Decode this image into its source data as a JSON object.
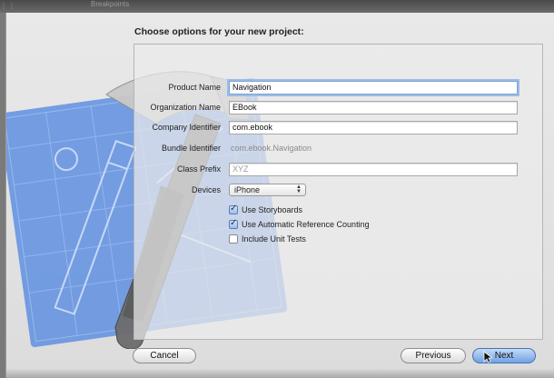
{
  "background": {
    "breakpoints_label": "Breakpoints"
  },
  "dialog": {
    "title": "Choose options for your new project:"
  },
  "form": {
    "product_name": {
      "label": "Product Name",
      "value": "Navigation"
    },
    "organization_name": {
      "label": "Organization Name",
      "value": "EBook"
    },
    "company_identifier": {
      "label": "Company Identifier",
      "value": "com.ebook"
    },
    "bundle_identifier": {
      "label": "Bundle Identifier",
      "value": "com.ebook.Navigation"
    },
    "class_prefix": {
      "label": "Class Prefix",
      "placeholder": "XYZ"
    },
    "devices": {
      "label": "Devices",
      "value": "iPhone"
    },
    "checkboxes": [
      {
        "label": "Use Storyboards",
        "checked": true
      },
      {
        "label": "Use Automatic Reference Counting",
        "checked": true
      },
      {
        "label": "Include Unit Tests",
        "checked": false
      }
    ]
  },
  "buttons": {
    "cancel": "Cancel",
    "previous": "Previous",
    "next": "Next"
  },
  "colors": {
    "blueprint": "#5f8fe0",
    "focus_ring": "#9bbde6",
    "primary_button": "#6ea3e6"
  },
  "icons": {
    "devices_popup_arrows": "chevron-up-down-icon",
    "checkmark": "checkmark-icon",
    "cursor": "arrow-cursor-icon"
  }
}
